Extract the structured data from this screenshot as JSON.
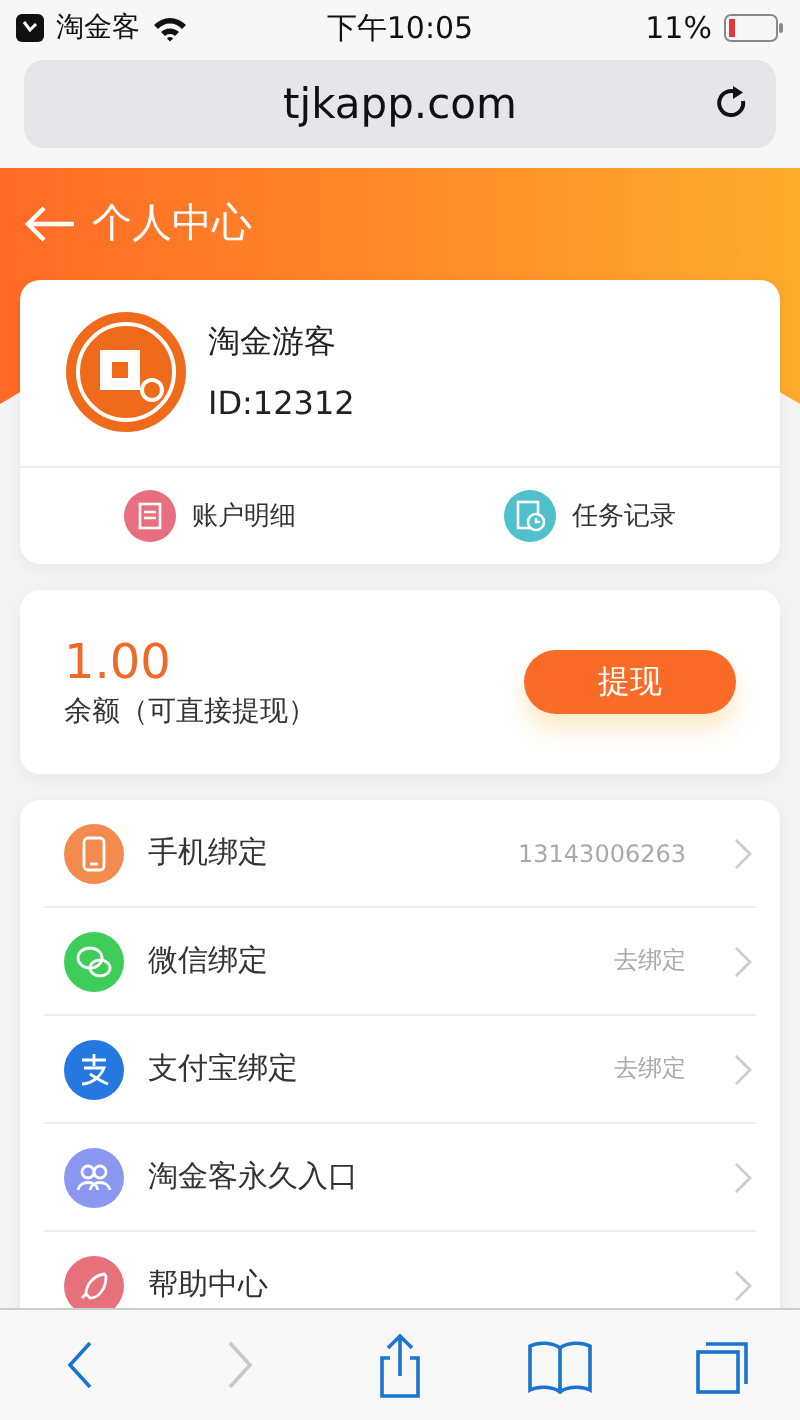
{
  "status_bar": {
    "carrier": "淘金客",
    "time": "下午10:05",
    "battery": "11%"
  },
  "address_bar": {
    "url": "tjkapp.com"
  },
  "header": {
    "title": "个人中心"
  },
  "profile": {
    "name": "淘金游客",
    "id": "ID:12312",
    "actions": [
      {
        "kind": "account",
        "label": "账户明细",
        "color": "#e8707e"
      },
      {
        "kind": "tasks",
        "label": "任务记录",
        "color": "#4fc0cc"
      }
    ]
  },
  "balance": {
    "amount": "1.00",
    "label": "余额（可直接提现）",
    "button": "提现"
  },
  "menu": [
    {
      "kind": "phone",
      "label": "手机绑定",
      "value": "13143006263",
      "color": "#f38a4e"
    },
    {
      "kind": "wechat",
      "label": "微信绑定",
      "value": "去绑定",
      "color": "#3fcd5a"
    },
    {
      "kind": "alipay",
      "label": "支付宝绑定",
      "value": "去绑定",
      "color": "#2478e0"
    },
    {
      "kind": "entry",
      "label": "淘金客永久入口",
      "color": "#8c97f2"
    },
    {
      "kind": "help",
      "label": "帮助中心",
      "color": "#e7717a"
    }
  ],
  "toolbar": [
    {
      "kind": "back",
      "disabled": false
    },
    {
      "kind": "forward",
      "disabled": true
    },
    {
      "kind": "share",
      "disabled": false
    },
    {
      "kind": "bookmarks",
      "disabled": false
    },
    {
      "kind": "tabs",
      "disabled": false
    }
  ]
}
